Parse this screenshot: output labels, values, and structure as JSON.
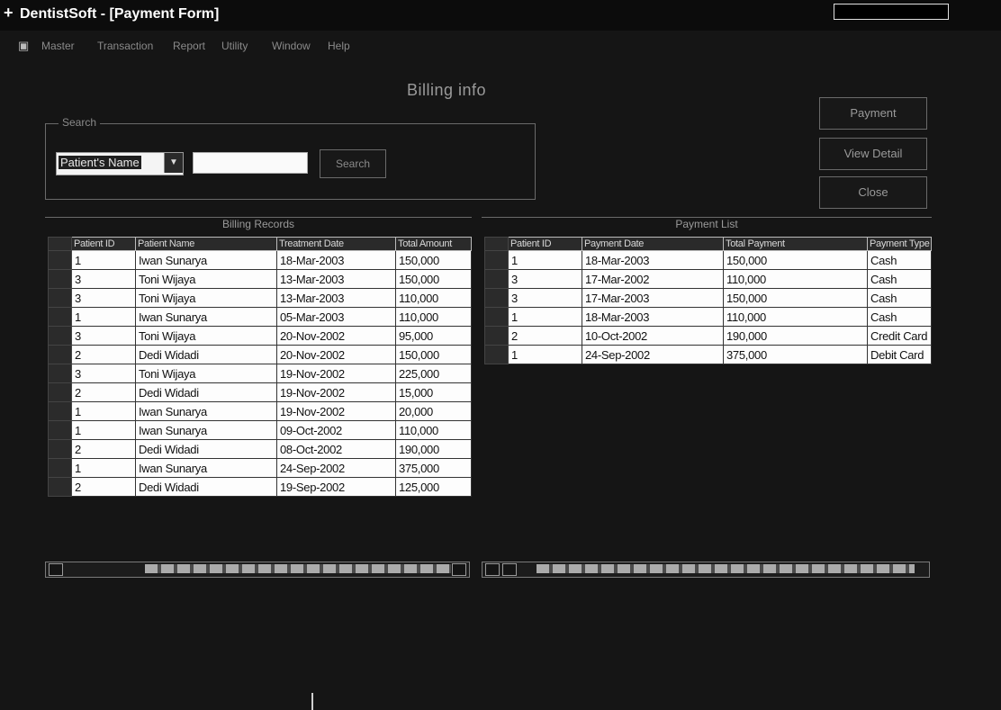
{
  "window": {
    "title": "DentistSoft - [Payment Form]"
  },
  "menu": {
    "items": [
      "Master",
      "Transaction",
      "Report",
      "Utility",
      "Window",
      "Help"
    ]
  },
  "form_title": "Billing info",
  "search": {
    "group_label": "Search",
    "field_option": "Patient's Name",
    "value": "",
    "button_label": "Search"
  },
  "side_buttons": {
    "payment": "Payment",
    "view_detail": "View Detail",
    "close": "Close"
  },
  "billing_grid": {
    "caption": "Billing Records",
    "columns": [
      "Patient ID",
      "Patient Name",
      "Treatment Date",
      "Total Amount"
    ],
    "rows": [
      [
        "1",
        "Iwan Sunarya",
        "18-Mar-2003",
        "150,000"
      ],
      [
        "3",
        "Toni Wijaya",
        "13-Mar-2003",
        "150,000"
      ],
      [
        "3",
        "Toni Wijaya",
        "13-Mar-2003",
        "110,000"
      ],
      [
        "1",
        "Iwan Sunarya",
        "05-Mar-2003",
        "110,000"
      ],
      [
        "3",
        "Toni Wijaya",
        "20-Nov-2002",
        "95,000"
      ],
      [
        "2",
        "Dedi Widadi",
        "20-Nov-2002",
        "150,000"
      ],
      [
        "3",
        "Toni Wijaya",
        "19-Nov-2002",
        "225,000"
      ],
      [
        "2",
        "Dedi Widadi",
        "19-Nov-2002",
        "15,000"
      ],
      [
        "1",
        "Iwan Sunarya",
        "19-Nov-2002",
        "20,000"
      ],
      [
        "1",
        "Iwan Sunarya",
        "09-Oct-2002",
        "110,000"
      ],
      [
        "2",
        "Dedi Widadi",
        "08-Oct-2002",
        "190,000"
      ],
      [
        "1",
        "Iwan Sunarya",
        "24-Sep-2002",
        "375,000"
      ],
      [
        "2",
        "Dedi Widadi",
        "19-Sep-2002",
        "125,000"
      ]
    ]
  },
  "payment_grid": {
    "caption": "Payment List",
    "columns": [
      "Patient ID",
      "Payment Date",
      "Total Payment",
      "Payment Type"
    ],
    "rows": [
      [
        "1",
        "18-Mar-2003",
        "150,000",
        "Cash"
      ],
      [
        "3",
        "17-Mar-2002",
        "110,000",
        "Cash"
      ],
      [
        "3",
        "17-Mar-2003",
        "150,000",
        "Cash"
      ],
      [
        "1",
        "18-Mar-2003",
        "110,000",
        "Cash"
      ],
      [
        "2",
        "10-Oct-2002",
        "190,000",
        "Credit Card"
      ],
      [
        "1",
        "24-Sep-2002",
        "375,000",
        "Debit Card"
      ]
    ]
  }
}
